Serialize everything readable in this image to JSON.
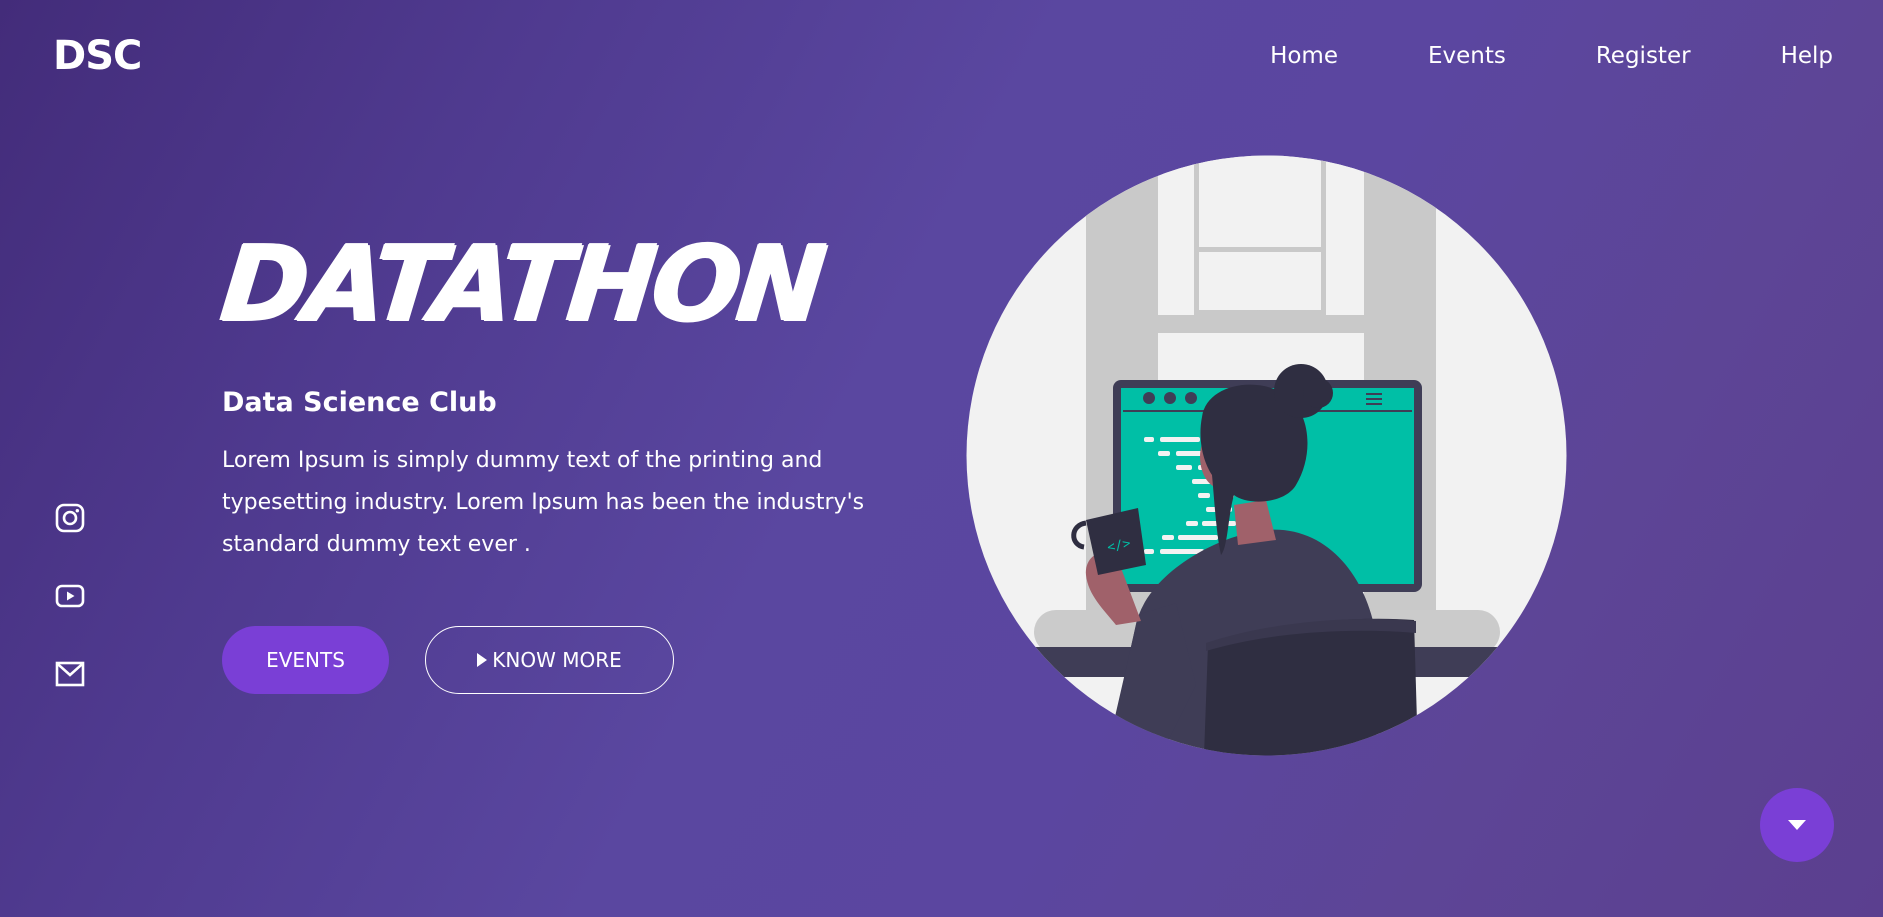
{
  "header": {
    "logo": "DSC",
    "nav": [
      {
        "label": "Home"
      },
      {
        "label": "Events"
      },
      {
        "label": "Register"
      },
      {
        "label": "Help"
      }
    ]
  },
  "social": [
    {
      "icon": "instagram-icon"
    },
    {
      "icon": "youtube-icon"
    },
    {
      "icon": "mail-icon"
    }
  ],
  "hero": {
    "title": "DATATHON",
    "subtitle": "Data Science Club",
    "description": "Lorem Ipsum is simply dummy text of the printing and typesetting industry. Lorem Ipsum has been the industry's standard dummy text ever .",
    "primary_button": "EVENTS",
    "secondary_button": "KNOW MORE",
    "illustration": {
      "icon": "woman-at-computer-illustration",
      "screen_text": "</>"
    }
  },
  "colors": {
    "accent": "#7a3fd6",
    "screen": "#00bfa6",
    "background_start": "#432c7a",
    "background_end": "#5b3f8f"
  }
}
